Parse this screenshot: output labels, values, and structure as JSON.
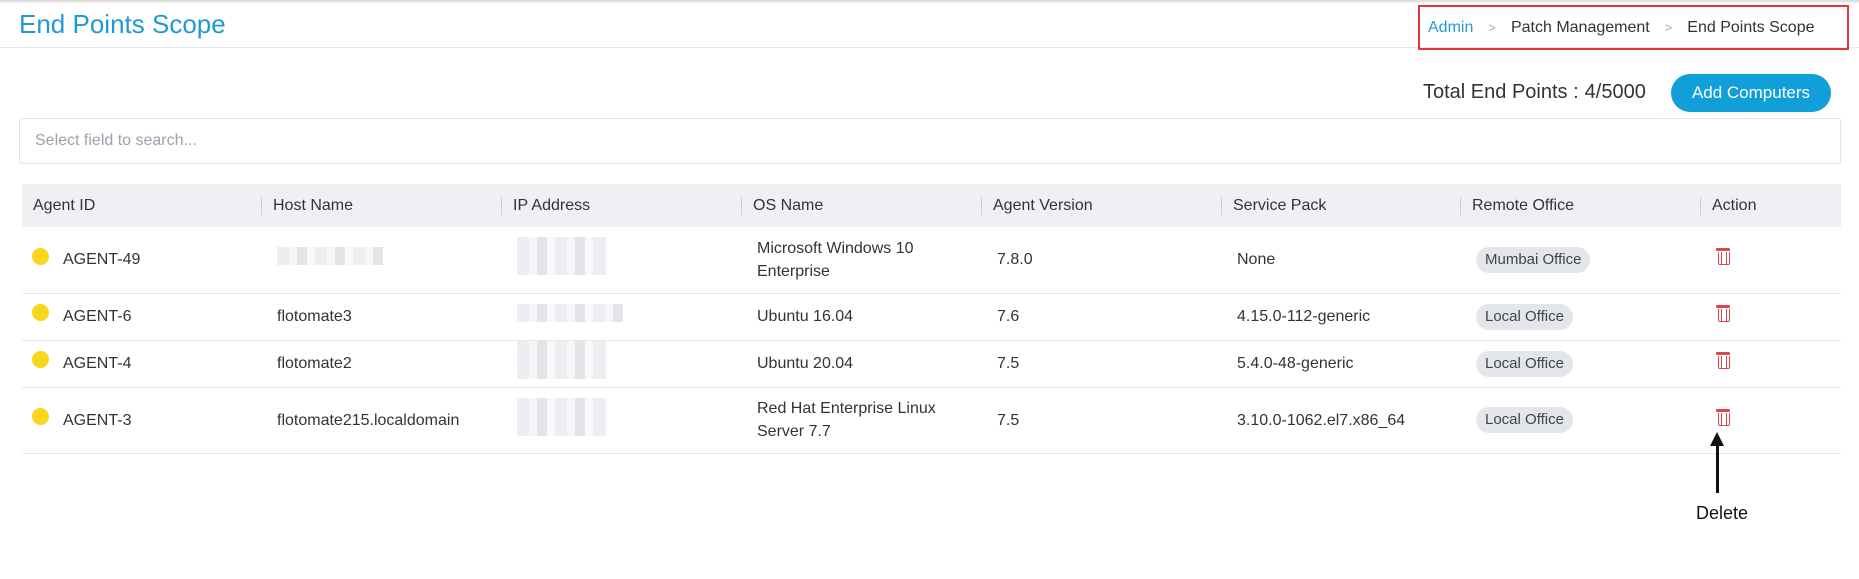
{
  "page": {
    "title": "End Points Scope"
  },
  "breadcrumb": {
    "items": [
      "Admin",
      "Patch Management",
      "End Points Scope"
    ]
  },
  "summary": {
    "label": "Total End Points :",
    "value": "4/5000"
  },
  "toolbar": {
    "add_label": "Add Computers"
  },
  "search": {
    "placeholder": "Select field to search..."
  },
  "table": {
    "columns": [
      "Agent ID",
      "Host Name",
      "IP Address",
      "OS Name",
      "Agent Version",
      "Service Pack",
      "Remote Office",
      "Action"
    ],
    "rows": [
      {
        "agent_id": "AGENT-49",
        "host_name": "",
        "ip_address": "",
        "os_name": "Microsoft Windows 10 Enterprise",
        "agent_version": "7.8.0",
        "service_pack": "None",
        "remote_office": "Mumbai Office"
      },
      {
        "agent_id": "AGENT-6",
        "host_name": "flotomate3",
        "ip_address": "",
        "os_name": "Ubuntu 16.04",
        "agent_version": "7.6",
        "service_pack": "4.15.0-112-generic",
        "remote_office": "Local Office"
      },
      {
        "agent_id": "AGENT-4",
        "host_name": "flotomate2",
        "ip_address": "",
        "os_name": "Ubuntu 20.04",
        "agent_version": "7.5",
        "service_pack": "5.4.0-48-generic",
        "remote_office": "Local Office"
      },
      {
        "agent_id": "AGENT-3",
        "host_name": "flotomate215.localdomain",
        "ip_address": "",
        "os_name": "Red Hat Enterprise Linux Server 7.7",
        "agent_version": "7.5",
        "service_pack": "3.10.0-1062.el7.x86_64",
        "remote_office": "Local Office"
      }
    ]
  },
  "annotation": {
    "label": "Delete"
  },
  "colors": {
    "accent": "#1f9ad6",
    "button": "#109fd8",
    "status_dot": "#f9d71c",
    "delete": "#e0474c",
    "highlight_box": "#e0353b"
  },
  "icons": {
    "status": "status-dot-icon",
    "action": "trash-icon",
    "annotation": "arrow-up-icon",
    "separator": "chevron-right-icon"
  }
}
